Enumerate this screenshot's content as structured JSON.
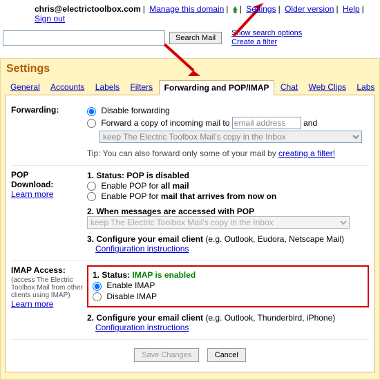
{
  "topbar": {
    "email": "chris@electrictoolbox.com",
    "manage_domain": "Manage this domain",
    "settings": "Settings",
    "older_version": "Older version",
    "help": "Help",
    "sign_out": "Sign out"
  },
  "search": {
    "button": "Search Mail",
    "show_options": "Show search options",
    "create_filter": "Create a filter"
  },
  "panel": {
    "title": "Settings"
  },
  "tabs": {
    "general": "General",
    "accounts": "Accounts",
    "labels": "Labels",
    "filters": "Filters",
    "forwarding": "Forwarding and POP/IMAP",
    "chat": "Chat",
    "webclips": "Web Clips",
    "labs": "Labs"
  },
  "forwarding": {
    "label": "Forwarding:",
    "disable": "Disable forwarding",
    "forward_copy_prefix": "Forward a copy of incoming mail to ",
    "email_placeholder": "email address",
    "and": " and",
    "keep_option": "keep The Electric Toolbox Mail's copy in the Inbox",
    "tip_prefix": "Tip: You can also forward only some of your mail by ",
    "tip_link": "creating a filter!"
  },
  "pop": {
    "label_line1": "POP",
    "label_line2": "Download:",
    "learn_more": "Learn more",
    "status_label": "1. Status: ",
    "status_value": "POP is disabled",
    "opt_all_prefix": "Enable POP for ",
    "opt_all_bold": "all mail",
    "opt_now_prefix": "Enable POP for ",
    "opt_now_bold": "mail that arrives from now on",
    "access_heading": "2. When messages are accessed with POP",
    "access_option": "keep The Electric Toolbox Mail's copy in the Inbox",
    "configure_prefix": "3. Configure your email client ",
    "configure_suffix": "(e.g. Outlook, Eudora, Netscape Mail)",
    "config_link": "Configuration instructions"
  },
  "imap": {
    "label": "IMAP Access:",
    "sub": "(access The Electric Toolbox Mail from other clients using IMAP)",
    "learn_more": "Learn more",
    "status_label": "1. Status: ",
    "status_value": "IMAP is enabled",
    "enable": "Enable IMAP",
    "disable": "Disable IMAP",
    "configure_prefix": "2. Configure your email client ",
    "configure_suffix": "(e.g. Outlook, Thunderbird, iPhone)",
    "config_link": "Configuration instructions"
  },
  "buttons": {
    "save": "Save Changes",
    "cancel": "Cancel"
  }
}
